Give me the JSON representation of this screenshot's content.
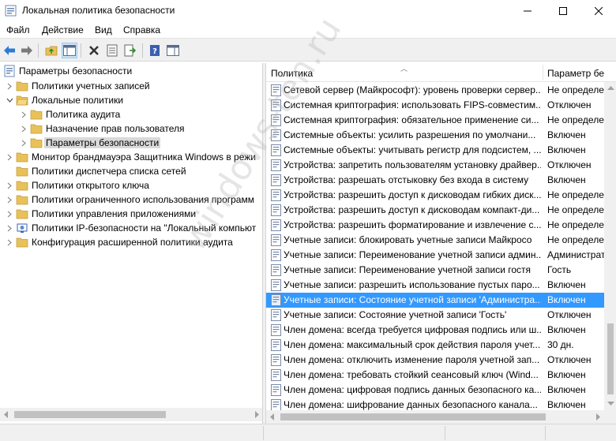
{
  "window": {
    "title": "Локальная политика безопасности"
  },
  "menu": {
    "items": [
      "Файл",
      "Действие",
      "Вид",
      "Справка"
    ]
  },
  "toolbar": {
    "icons": [
      "back-icon",
      "forward-icon",
      "up-folder-icon",
      "console-tree-icon",
      "delete-icon",
      "properties-icon",
      "export-icon",
      "help-icon",
      "extra-view-icon"
    ]
  },
  "colors": {
    "selection": "#3399ff",
    "folder": "#e8c15a",
    "tree_selection": "#d9d9d9"
  },
  "tree": {
    "root": "Параметры безопасности",
    "items": [
      {
        "label": "Политики учетных записей",
        "level": 1,
        "expanded": false
      },
      {
        "label": "Локальные политики",
        "level": 1,
        "expanded": true
      },
      {
        "label": "Политика аудита",
        "level": 2,
        "expanded": false
      },
      {
        "label": "Назначение прав пользователя",
        "level": 2,
        "expanded": false
      },
      {
        "label": "Параметры безопасности",
        "level": 2,
        "expanded": false,
        "selected": true
      },
      {
        "label": "Монитор брандмауэра Защитника Windows в режи",
        "level": 1,
        "expanded": false
      },
      {
        "label": "Политики диспетчера списка сетей",
        "level": 1
      },
      {
        "label": "Политики открытого ключа",
        "level": 1,
        "expanded": false
      },
      {
        "label": "Политики ограниченного использования программ",
        "level": 1,
        "expanded": false
      },
      {
        "label": "Политики управления приложениями",
        "level": 1,
        "expanded": false
      },
      {
        "label": "Политики IP-безопасности на \"Локальный компьют",
        "level": 1,
        "expanded": false
      },
      {
        "label": "Конфигурация расширенной политики аудита",
        "level": 1,
        "expanded": false
      }
    ]
  },
  "list": {
    "columns": [
      "Политика",
      "Параметр бе"
    ],
    "rows": [
      {
        "policy": "Сетевой сервер (Майкрософт): уровень проверки сервер...",
        "value": "Не определе"
      },
      {
        "policy": "Системная криптография: использовать FIPS-совместим...",
        "value": "Отключен"
      },
      {
        "policy": "Системная криптография: обязательное применение си...",
        "value": "Не определе"
      },
      {
        "policy": "Системные объекты: усилить разрешения по умолчани...",
        "value": "Включен"
      },
      {
        "policy": "Системные объекты: учитывать регистр для подсистем, ...",
        "value": "Включен"
      },
      {
        "policy": "Устройства: запретить пользователям установку драйвер...",
        "value": "Отключен"
      },
      {
        "policy": "Устройства: разрешать отстыковку без входа в систему",
        "value": "Включен"
      },
      {
        "policy": "Устройства: разрешить доступ к дисководам гибких диск...",
        "value": "Не определе"
      },
      {
        "policy": "Устройства: разрешить доступ к дисководам компакт-ди...",
        "value": "Не определе"
      },
      {
        "policy": "Устройства: разрешить форматирование и извлечение с...",
        "value": "Не определе"
      },
      {
        "policy": "Учетные записи: блокировать учетные записи Майкросо",
        "value": "Не определе"
      },
      {
        "policy": "Учетные записи: Переименование учетной записи админ...",
        "value": "Администрат"
      },
      {
        "policy": "Учетные записи: Переименование учетной записи гостя",
        "value": "Гость"
      },
      {
        "policy": "Учетные записи: разрешить использование пустых паро...",
        "value": "Включен"
      },
      {
        "policy": "Учетные записи: Состояние учетной записи 'Администра...",
        "value": "Включен",
        "selected": true
      },
      {
        "policy": "Учетные записи: Состояние учетной записи 'Гость'",
        "value": "Отключен"
      },
      {
        "policy": "Член домена: всегда требуется цифровая подпись или ш...",
        "value": "Включен"
      },
      {
        "policy": "Член домена: максимальный срок действия пароля учет...",
        "value": "30 дн."
      },
      {
        "policy": "Член домена: отключить изменение пароля учетной зап...",
        "value": "Отключен"
      },
      {
        "policy": "Член домена: требовать стойкий сеансовый ключ (Wind...",
        "value": "Включен"
      },
      {
        "policy": "Член домена: цифровая подпись данных безопасного ка...",
        "value": "Включен"
      },
      {
        "policy": "Член домена: шифрование данных безопасного канала...",
        "value": "Включен"
      }
    ]
  },
  "watermark": "windows-ten.ru"
}
